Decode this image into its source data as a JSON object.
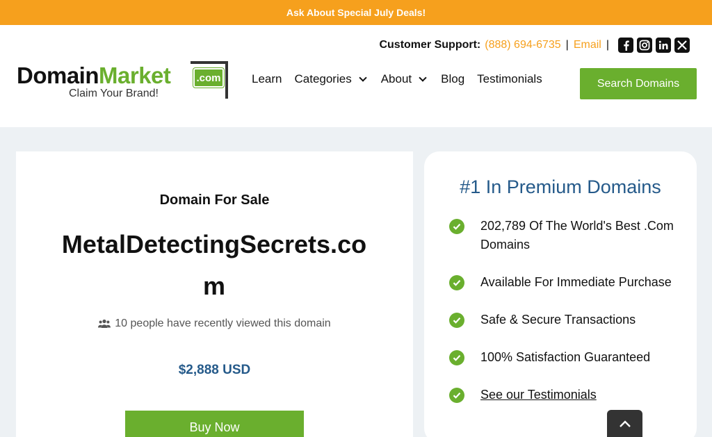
{
  "promo": {
    "text": "Ask About Special July Deals!"
  },
  "header": {
    "support_label": "Customer Support:",
    "phone": "(888) 694-6735",
    "email": "Email",
    "separator": "|",
    "social": [
      "facebook-icon",
      "instagram-icon",
      "linkedin-icon",
      "x-icon"
    ]
  },
  "logo": {
    "domain": "Domain",
    "market": "Market",
    "com": ".com",
    "tagline": "Claim Your Brand!"
  },
  "nav": {
    "items": [
      {
        "label": "Learn"
      },
      {
        "label": "Categories",
        "dropdown": true
      },
      {
        "label": "About",
        "dropdown": true
      },
      {
        "label": "Blog"
      },
      {
        "label": "Testimonials"
      }
    ],
    "search_button": "Search Domains"
  },
  "listing": {
    "heading": "Domain For Sale",
    "domain": "MetalDetectingSecrets.com",
    "viewers": "10 people have recently viewed this domain",
    "price": "$2,888 USD",
    "buy_button": "Buy Now"
  },
  "benefits": {
    "title": "#1 In Premium Domains",
    "items": [
      "202,789 Of The World's Best .Com Domains",
      "Available For Immediate Purchase",
      "Safe & Secure Transactions",
      "100% Satisfaction Guaranteed",
      "See our Testimonials"
    ]
  },
  "colors": {
    "accent_orange": "#f6a01d",
    "brand_green": "#6aaf2e",
    "brand_blue": "#255a8a"
  }
}
